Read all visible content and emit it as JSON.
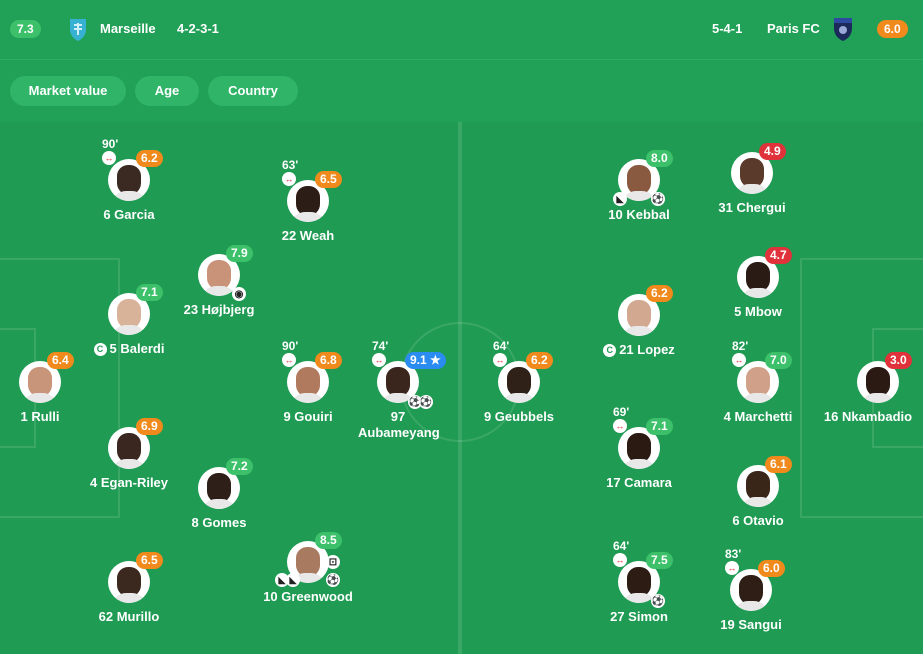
{
  "home": {
    "rating": "7.3",
    "name": "Marseille",
    "formation": "4-2-3-1"
  },
  "away": {
    "rating": "6.0",
    "name": "Paris FC",
    "formation": "5-4-1"
  },
  "filters": [
    "Market value",
    "Age",
    "Country"
  ],
  "colors": {
    "green": "#3cc16a",
    "orange": "#f08a1c",
    "red": "#e0323a",
    "blue": "#2a8cf0",
    "pitch": "#1f9b53"
  },
  "players": [
    {
      "name": "6 Garcia",
      "rating": "6.2",
      "sub": "90'"
    },
    {
      "name": "22 Weah",
      "rating": "6.5",
      "sub": "63'"
    },
    {
      "name": "23 Højbjerg",
      "rating": "7.9"
    },
    {
      "name": "5 Balerdi",
      "rating": "7.1"
    },
    {
      "name": "1 Rulli",
      "rating": "6.4"
    },
    {
      "name": "9 Gouiri",
      "rating": "6.8",
      "sub": "90'"
    },
    {
      "name": "97 Aubameyang",
      "rating": "9.1",
      "sub": "74'"
    },
    {
      "name": "4 Egan-Riley",
      "rating": "6.9"
    },
    {
      "name": "8 Gomes",
      "rating": "7.2"
    },
    {
      "name": "62 Murillo",
      "rating": "6.5"
    },
    {
      "name": "10 Greenwood",
      "rating": "8.5"
    },
    {
      "name": "10 Kebbal",
      "rating": "8.0"
    },
    {
      "name": "31 Chergui",
      "rating": "4.9"
    },
    {
      "name": "5 Mbow",
      "rating": "4.7"
    },
    {
      "name": "21 Lopez",
      "rating": "6.2"
    },
    {
      "name": "9 Geubbels",
      "rating": "6.2",
      "sub": "64'"
    },
    {
      "name": "4 Marchetti",
      "rating": "7.0",
      "sub": "82'"
    },
    {
      "name": "16 Nkambadio",
      "rating": "3.0"
    },
    {
      "name": "17 Camara",
      "rating": "7.1",
      "sub": "69'"
    },
    {
      "name": "6 Otavio",
      "rating": "6.1"
    },
    {
      "name": "27 Simon",
      "rating": "7.5",
      "sub": "64'"
    },
    {
      "name": "19 Sangui",
      "rating": "6.0",
      "sub": "83'"
    }
  ]
}
